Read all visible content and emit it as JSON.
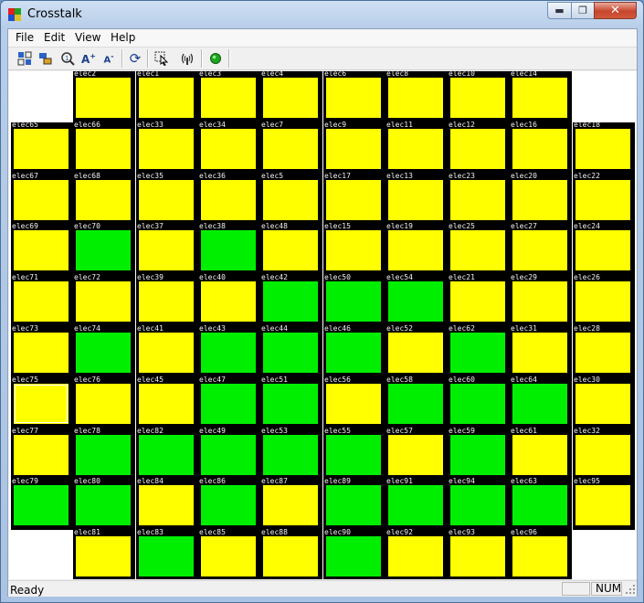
{
  "window": {
    "title": "Crosstalk"
  },
  "menu": [
    "File",
    "Edit",
    "View",
    "Help"
  ],
  "toolbar_icons": [
    "layout-icon",
    "arrange-icon",
    "zoom-info-icon",
    "font-increase-icon",
    "font-decrease-icon",
    "refresh-icon",
    "select-icon",
    "signal-icon",
    "run-icon"
  ],
  "colors": {
    "active": "#00ef00",
    "inactive": "#ffff00",
    "cell_border": "#000000"
  },
  "electrodes": [
    {
      "label": "elec2",
      "row": 0,
      "col": 1,
      "state": "inactive"
    },
    {
      "label": "elec1",
      "row": 0,
      "col": 2,
      "state": "inactive"
    },
    {
      "label": "elec3",
      "row": 0,
      "col": 3,
      "state": "inactive"
    },
    {
      "label": "elec4",
      "row": 0,
      "col": 4,
      "state": "inactive"
    },
    {
      "label": "elec6",
      "row": 0,
      "col": 5,
      "state": "inactive"
    },
    {
      "label": "elec8",
      "row": 0,
      "col": 6,
      "state": "inactive"
    },
    {
      "label": "elec10",
      "row": 0,
      "col": 7,
      "state": "inactive"
    },
    {
      "label": "elec14",
      "row": 0,
      "col": 8,
      "state": "inactive"
    },
    {
      "label": "elec65",
      "row": 1,
      "col": 0,
      "state": "inactive"
    },
    {
      "label": "elec66",
      "row": 1,
      "col": 1,
      "state": "inactive"
    },
    {
      "label": "elec33",
      "row": 1,
      "col": 2,
      "state": "inactive"
    },
    {
      "label": "elec34",
      "row": 1,
      "col": 3,
      "state": "inactive"
    },
    {
      "label": "elec7",
      "row": 1,
      "col": 4,
      "state": "inactive"
    },
    {
      "label": "elec9",
      "row": 1,
      "col": 5,
      "state": "inactive"
    },
    {
      "label": "elec11",
      "row": 1,
      "col": 6,
      "state": "inactive"
    },
    {
      "label": "elec12",
      "row": 1,
      "col": 7,
      "state": "inactive"
    },
    {
      "label": "elec16",
      "row": 1,
      "col": 8,
      "state": "inactive"
    },
    {
      "label": "elec18",
      "row": 1,
      "col": 9,
      "state": "inactive"
    },
    {
      "label": "elec67",
      "row": 2,
      "col": 0,
      "state": "inactive"
    },
    {
      "label": "elec68",
      "row": 2,
      "col": 1,
      "state": "inactive"
    },
    {
      "label": "elec35",
      "row": 2,
      "col": 2,
      "state": "inactive"
    },
    {
      "label": "elec36",
      "row": 2,
      "col": 3,
      "state": "inactive"
    },
    {
      "label": "elec5",
      "row": 2,
      "col": 4,
      "state": "inactive"
    },
    {
      "label": "elec17",
      "row": 2,
      "col": 5,
      "state": "inactive"
    },
    {
      "label": "elec13",
      "row": 2,
      "col": 6,
      "state": "inactive"
    },
    {
      "label": "elec23",
      "row": 2,
      "col": 7,
      "state": "inactive"
    },
    {
      "label": "elec20",
      "row": 2,
      "col": 8,
      "state": "inactive"
    },
    {
      "label": "elec22",
      "row": 2,
      "col": 9,
      "state": "inactive"
    },
    {
      "label": "elec69",
      "row": 3,
      "col": 0,
      "state": "inactive"
    },
    {
      "label": "elec70",
      "row": 3,
      "col": 1,
      "state": "active"
    },
    {
      "label": "elec37",
      "row": 3,
      "col": 2,
      "state": "inactive"
    },
    {
      "label": "elec38",
      "row": 3,
      "col": 3,
      "state": "active"
    },
    {
      "label": "elec48",
      "row": 3,
      "col": 4,
      "state": "inactive"
    },
    {
      "label": "elec15",
      "row": 3,
      "col": 5,
      "state": "inactive"
    },
    {
      "label": "elec19",
      "row": 3,
      "col": 6,
      "state": "inactive"
    },
    {
      "label": "elec25",
      "row": 3,
      "col": 7,
      "state": "inactive"
    },
    {
      "label": "elec27",
      "row": 3,
      "col": 8,
      "state": "inactive"
    },
    {
      "label": "elec24",
      "row": 3,
      "col": 9,
      "state": "inactive"
    },
    {
      "label": "elec71",
      "row": 4,
      "col": 0,
      "state": "inactive"
    },
    {
      "label": "elec72",
      "row": 4,
      "col": 1,
      "state": "inactive"
    },
    {
      "label": "elec39",
      "row": 4,
      "col": 2,
      "state": "inactive"
    },
    {
      "label": "elec40",
      "row": 4,
      "col": 3,
      "state": "inactive"
    },
    {
      "label": "elec42",
      "row": 4,
      "col": 4,
      "state": "active"
    },
    {
      "label": "elec50",
      "row": 4,
      "col": 5,
      "state": "active"
    },
    {
      "label": "elec54",
      "row": 4,
      "col": 6,
      "state": "active"
    },
    {
      "label": "elec21",
      "row": 4,
      "col": 7,
      "state": "inactive"
    },
    {
      "label": "elec29",
      "row": 4,
      "col": 8,
      "state": "inactive"
    },
    {
      "label": "elec26",
      "row": 4,
      "col": 9,
      "state": "inactive"
    },
    {
      "label": "elec73",
      "row": 5,
      "col": 0,
      "state": "inactive"
    },
    {
      "label": "elec74",
      "row": 5,
      "col": 1,
      "state": "active"
    },
    {
      "label": "elec41",
      "row": 5,
      "col": 2,
      "state": "inactive"
    },
    {
      "label": "elec43",
      "row": 5,
      "col": 3,
      "state": "active"
    },
    {
      "label": "elec44",
      "row": 5,
      "col": 4,
      "state": "active"
    },
    {
      "label": "elec46",
      "row": 5,
      "col": 5,
      "state": "active"
    },
    {
      "label": "elec52",
      "row": 5,
      "col": 6,
      "state": "inactive"
    },
    {
      "label": "elec62",
      "row": 5,
      "col": 7,
      "state": "active"
    },
    {
      "label": "elec31",
      "row": 5,
      "col": 8,
      "state": "inactive"
    },
    {
      "label": "elec28",
      "row": 5,
      "col": 9,
      "state": "inactive"
    },
    {
      "label": "elec75",
      "row": 6,
      "col": 0,
      "state": "inactive",
      "selected": true
    },
    {
      "label": "elec76",
      "row": 6,
      "col": 1,
      "state": "inactive"
    },
    {
      "label": "elec45",
      "row": 6,
      "col": 2,
      "state": "inactive"
    },
    {
      "label": "elec47",
      "row": 6,
      "col": 3,
      "state": "active"
    },
    {
      "label": "elec51",
      "row": 6,
      "col": 4,
      "state": "active"
    },
    {
      "label": "elec56",
      "row": 6,
      "col": 5,
      "state": "inactive"
    },
    {
      "label": "elec58",
      "row": 6,
      "col": 6,
      "state": "active"
    },
    {
      "label": "elec60",
      "row": 6,
      "col": 7,
      "state": "active"
    },
    {
      "label": "elec64",
      "row": 6,
      "col": 8,
      "state": "active"
    },
    {
      "label": "elec30",
      "row": 6,
      "col": 9,
      "state": "inactive"
    },
    {
      "label": "elec77",
      "row": 7,
      "col": 0,
      "state": "inactive"
    },
    {
      "label": "elec78",
      "row": 7,
      "col": 1,
      "state": "active"
    },
    {
      "label": "elec82",
      "row": 7,
      "col": 2,
      "state": "active"
    },
    {
      "label": "elec49",
      "row": 7,
      "col": 3,
      "state": "active"
    },
    {
      "label": "elec53",
      "row": 7,
      "col": 4,
      "state": "active"
    },
    {
      "label": "elec55",
      "row": 7,
      "col": 5,
      "state": "active"
    },
    {
      "label": "elec57",
      "row": 7,
      "col": 6,
      "state": "inactive"
    },
    {
      "label": "elec59",
      "row": 7,
      "col": 7,
      "state": "active"
    },
    {
      "label": "elec61",
      "row": 7,
      "col": 8,
      "state": "inactive"
    },
    {
      "label": "elec32",
      "row": 7,
      "col": 9,
      "state": "inactive"
    },
    {
      "label": "elec79",
      "row": 8,
      "col": 0,
      "state": "active"
    },
    {
      "label": "elec80",
      "row": 8,
      "col": 1,
      "state": "active"
    },
    {
      "label": "elec84",
      "row": 8,
      "col": 2,
      "state": "inactive"
    },
    {
      "label": "elec86",
      "row": 8,
      "col": 3,
      "state": "active"
    },
    {
      "label": "elec87",
      "row": 8,
      "col": 4,
      "state": "inactive"
    },
    {
      "label": "elec89",
      "row": 8,
      "col": 5,
      "state": "active"
    },
    {
      "label": "elec91",
      "row": 8,
      "col": 6,
      "state": "active"
    },
    {
      "label": "elec94",
      "row": 8,
      "col": 7,
      "state": "active"
    },
    {
      "label": "elec63",
      "row": 8,
      "col": 8,
      "state": "active"
    },
    {
      "label": "elec95",
      "row": 8,
      "col": 9,
      "state": "inactive"
    },
    {
      "label": "elec81",
      "row": 9,
      "col": 1,
      "state": "inactive"
    },
    {
      "label": "elec83",
      "row": 9,
      "col": 2,
      "state": "active"
    },
    {
      "label": "elec85",
      "row": 9,
      "col": 3,
      "state": "inactive"
    },
    {
      "label": "elec88",
      "row": 9,
      "col": 4,
      "state": "inactive"
    },
    {
      "label": "elec90",
      "row": 9,
      "col": 5,
      "state": "active"
    },
    {
      "label": "elec92",
      "row": 9,
      "col": 6,
      "state": "inactive"
    },
    {
      "label": "elec93",
      "row": 9,
      "col": 7,
      "state": "inactive"
    },
    {
      "label": "elec96",
      "row": 9,
      "col": 8,
      "state": "inactive"
    }
  ],
  "status": {
    "text": "Ready",
    "pane_empty": "",
    "num": "NUM"
  }
}
